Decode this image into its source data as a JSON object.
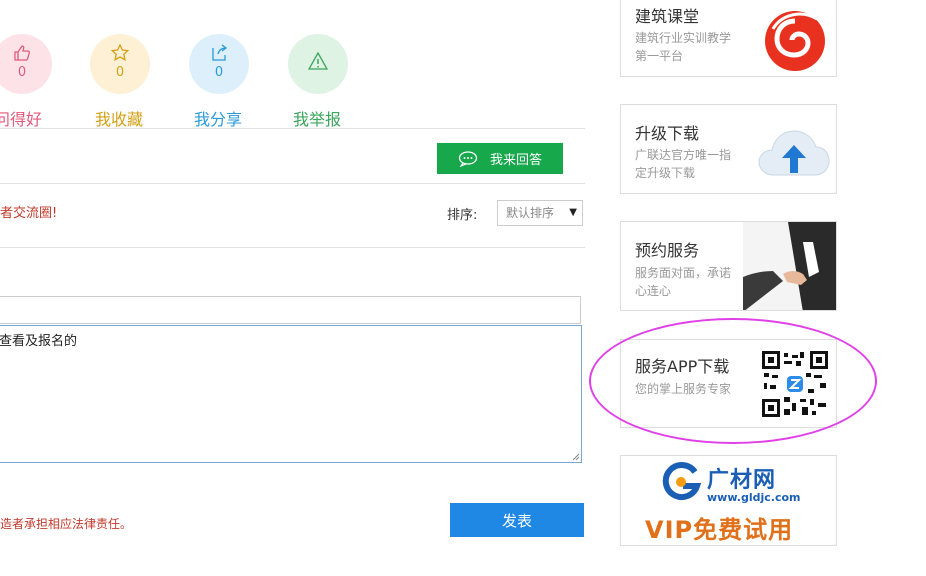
{
  "actions": [
    {
      "label": "问得好",
      "count": "0",
      "color": "#e05a7a",
      "bg": "#fde3e8",
      "icon": "thumbs-up-icon"
    },
    {
      "label": "我收藏",
      "count": "0",
      "color": "#d4a017",
      "bg": "#fdf0d5",
      "icon": "star-icon"
    },
    {
      "label": "我分享",
      "count": "0",
      "color": "#2a9bd8",
      "bg": "#dceffa",
      "icon": "share-icon"
    },
    {
      "label": "我举报",
      "count": "",
      "color": "#3aa55b",
      "bg": "#dff3e4",
      "icon": "warning-icon"
    }
  ],
  "answer_button": "我来回答",
  "circle_text": "者交流圈!",
  "sort": {
    "label": "排序:",
    "selected": "默认排序"
  },
  "textarea_value": "查看及报名的",
  "legal_text": "造者承担相应法律责任。",
  "publish_button": "发表",
  "sidebar": {
    "course": {
      "title": "建筑课堂",
      "desc": "建筑行业实训教学第一平台"
    },
    "upgrade": {
      "title": "升级下载",
      "desc": "广联达官方唯一指定升级下载"
    },
    "service": {
      "title": "预约服务",
      "desc": "服务面对面，承诺心连心"
    },
    "app": {
      "title": "服务APP下载",
      "desc": "您的掌上服务专家"
    },
    "ad": {
      "brand": "广材网",
      "url": "www.gldjc.com",
      "slogan": "VIP免费试用"
    }
  },
  "colors": {
    "green": "#17a84c",
    "blue": "#1f88e5",
    "magenta": "#e040e8",
    "red": "#c0392b"
  }
}
